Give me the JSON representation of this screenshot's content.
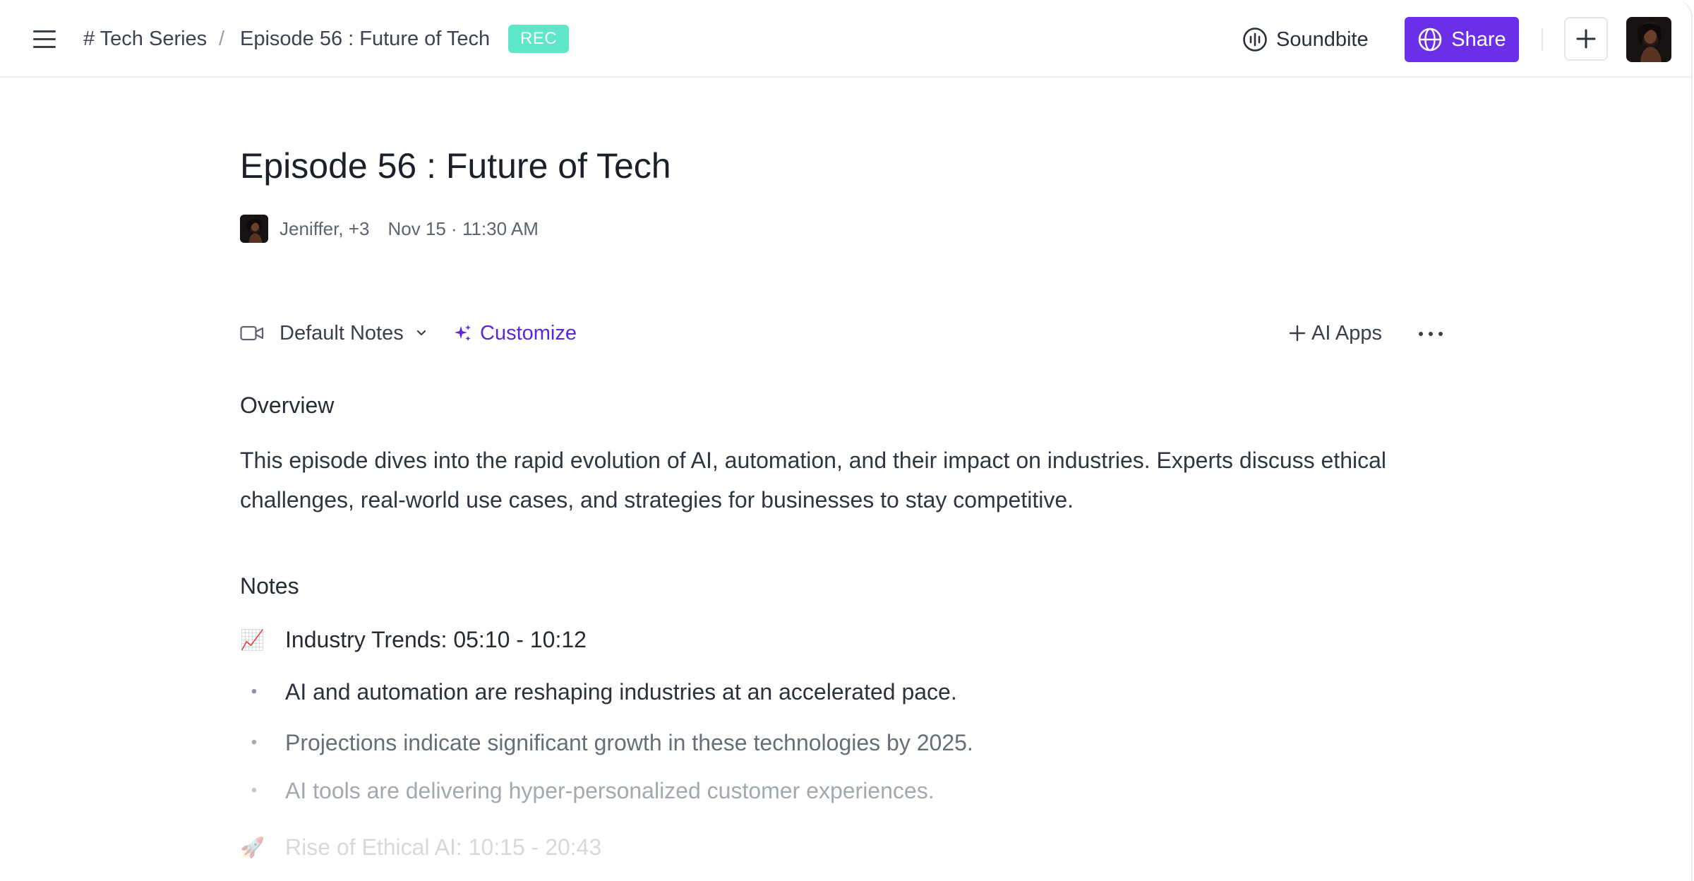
{
  "header": {
    "breadcrumb_parent": "# Tech Series",
    "breadcrumb_separator": "/",
    "breadcrumb_current": "Episode 56 : Future of Tech",
    "status_badge": "REC",
    "soundbite_label": "Soundbite",
    "share_label": "Share",
    "add_icon": "plus-icon",
    "menu_icon": "hamburger-menu-icon"
  },
  "meeting": {
    "title": "Episode 56 : Future of Tech",
    "participants": "Jeniffer, +3",
    "datetime": "Nov 15 · 11:30 AM"
  },
  "toolbar": {
    "template_label": "Default Notes",
    "customize_label": "Customize",
    "ai_apps_label": "AI Apps",
    "template_icon": "video-camera-icon",
    "customize_icon": "sparkles-icon"
  },
  "overview": {
    "heading": "Overview",
    "text": "This episode dives into the rapid evolution of AI, automation, and their impact on industries. Experts discuss ethical challenges, real-world use cases, and strategies for businesses to stay competitive."
  },
  "notes": {
    "heading": "Notes",
    "sections": [
      {
        "emoji": "📈",
        "title": "Industry Trends: 05:10 - 10:12",
        "bullets": [
          "AI and automation are reshaping industries at an accelerated pace.",
          "Projections indicate significant growth in these technologies by 2025.",
          "AI tools are delivering hyper-personalized customer experiences."
        ]
      },
      {
        "emoji": "🚀",
        "title": "Rise of Ethical AI: 10:15 - 20:43",
        "bullets": []
      }
    ]
  },
  "colors": {
    "accent": "#6a2fe6",
    "customize": "#5b27d9",
    "rec_badge": "#5ee6c8"
  }
}
